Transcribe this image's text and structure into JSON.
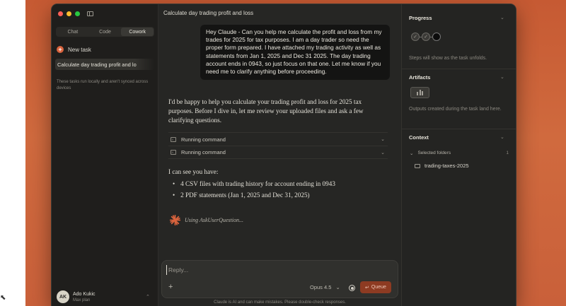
{
  "sidebar": {
    "mode_tabs": [
      "Chat",
      "Code",
      "Cowork"
    ],
    "active_mode": "Cowork",
    "new_task_label": "New task",
    "tasks": [
      {
        "label": "Calculate day trading profit and lo"
      }
    ],
    "local_note": "These tasks run locally and aren't synced across devices",
    "user": {
      "initials": "AK",
      "name": "Ado Kukic",
      "plan": "Max plan"
    }
  },
  "main": {
    "title": "Calculate day trading profit and loss",
    "user_message": "Hey Claude - Can you help me calculate the profit and loss from my trades for 2025 for tax purposes. I am a day trader so need the proper form prepared. I have attached my trading activity as well as statements from Jan 1, 2025 and Dec 31 2025. The day trading account ends in 0943, so just focus on that one. Let me know if you need me to clarify anything before proceeding.",
    "assistant_intro": "I'd be happy to help you calculate your trading profit and loss for 2025 tax purposes. Before I dive in, let me review your uploaded files and ask a few clarifying questions.",
    "commands": [
      {
        "label": "Running command"
      },
      {
        "label": "Running command"
      }
    ],
    "can_see": "I can see you have:",
    "bullets": [
      "4 CSV files with trading history for account ending in 0943",
      "2 PDF statements (Jan 1, 2025 and Dec 31, 2025)"
    ],
    "tool_status": "Using AskUserQuestion...",
    "composer": {
      "placeholder": "Reply...",
      "model": "Opus 4.5",
      "queue_label": "Queue"
    },
    "disclaimer": "Claude is AI and can make mistakes. Please double-check responses."
  },
  "right_panel": {
    "progress": {
      "title": "Progress",
      "note": "Steps will show as the task unfolds.",
      "steps": [
        "done",
        "done",
        "current"
      ]
    },
    "artifacts": {
      "title": "Artifacts",
      "note": "Outputs created during the task land here."
    },
    "context": {
      "title": "Context",
      "selected_folders_label": "Selected folders",
      "folder_count": "1",
      "folders": [
        "trading-taxes-2025"
      ]
    }
  },
  "colors": {
    "accent": "#d9633d",
    "background": "#262624",
    "sidebar": "#1f1e1c",
    "queue_button": "#8d3b22"
  }
}
